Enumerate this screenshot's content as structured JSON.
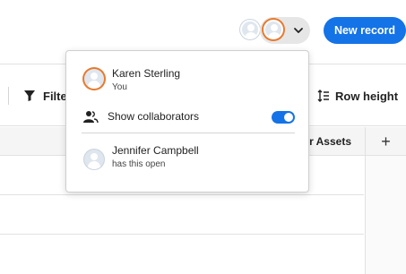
{
  "header": {
    "new_record_label": "New record",
    "collaborators_menu": {
      "self_avatar_ring_color": "#e87a2e",
      "chevron_icon": "chevron-down-icon"
    }
  },
  "toolbar": {
    "filter_label": "Filter",
    "row_height_label": "Row height"
  },
  "table": {
    "visible_column_header": "er Assets",
    "add_column_symbol": "+"
  },
  "collaborators_popover": {
    "current_user": {
      "name": "Karen Sterling",
      "subtitle": "You"
    },
    "show_collaborators": {
      "label": "Show collaborators",
      "enabled": true
    },
    "others": [
      {
        "name": "Jennifer Campbell",
        "subtitle": "has this open"
      }
    ]
  },
  "colors": {
    "accent": "#1473e6",
    "self_ring": "#e87a2e"
  }
}
